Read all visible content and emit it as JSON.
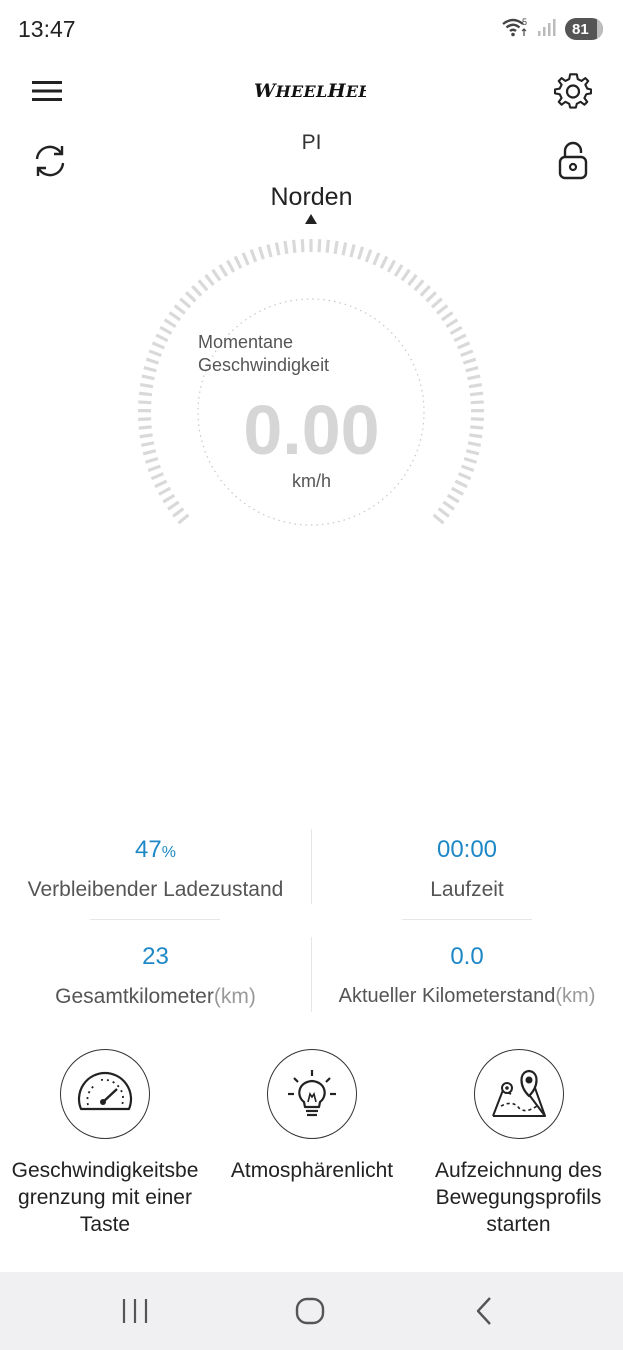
{
  "status_bar": {
    "time": "13:47",
    "battery": "81",
    "icons": [
      "wifi-icon",
      "signal-icon",
      "battery-icon"
    ]
  },
  "header": {
    "logo_text": "WheelHeels",
    "vehicle_name": "PI",
    "menu_icon": "menu-icon",
    "settings_icon": "gear-icon",
    "refresh_icon": "refresh-icon",
    "lock_icon": "lock-icon"
  },
  "compass": {
    "direction": "Norden"
  },
  "speedometer": {
    "caption_line1": "Momentane",
    "caption_line2": "Geschwindigkeit",
    "value": "0.00",
    "unit": "km/h",
    "level": 0
  },
  "stats": {
    "battery": {
      "value": "47",
      "unit": "%",
      "label": "Verbleibender Ladezustand"
    },
    "runtime": {
      "value": "00:00",
      "label": "Laufzeit"
    },
    "total_km": {
      "value": "23",
      "label": "Gesamtkilometer",
      "unit": "(km)"
    },
    "trip_km": {
      "value": "0.0",
      "label": "Aktueller Kilometerstand",
      "unit": "(km)"
    }
  },
  "actions": [
    {
      "label": "Geschwindigkeitsbe grenzung mit einer Taste",
      "icon": "speedometer-icon"
    },
    {
      "label": "Atmosphärenlicht",
      "icon": "lightbulb-icon"
    },
    {
      "label": "Aufzeichnung des Bewegungsprofils starten",
      "icon": "map-pin-icon"
    }
  ],
  "colors": {
    "accent": "#1e88c7",
    "gauge_tick": "#d9d9d9",
    "speed_text": "#d6d6d6"
  }
}
